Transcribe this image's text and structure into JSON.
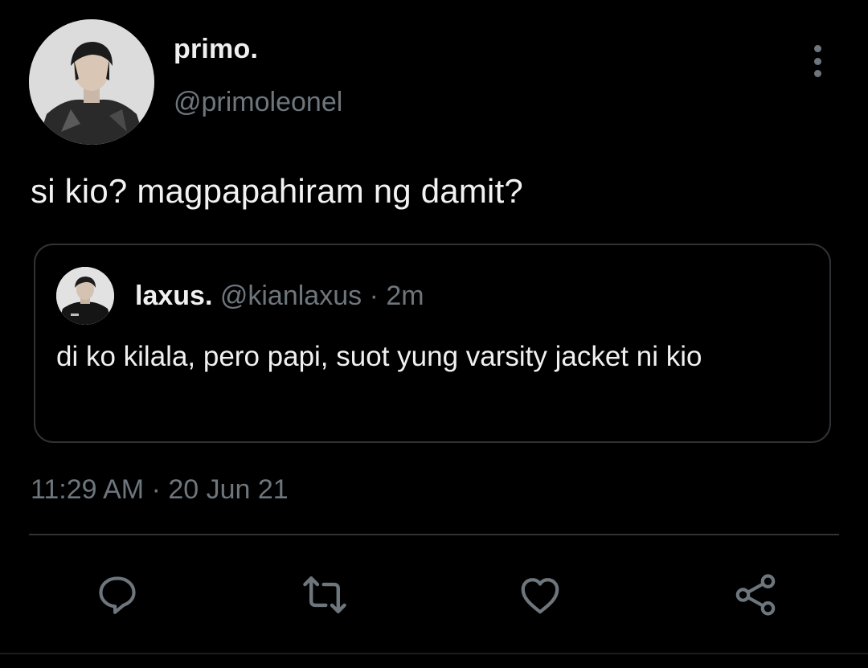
{
  "tweet": {
    "author": {
      "display_name": "primo.",
      "handle": "@primoleonel",
      "avatar_icon": "profile-photo"
    },
    "text": "si kio? magpapahiram ng damit?",
    "timestamp": "11:29 AM · 20 Jun 21"
  },
  "quote": {
    "author": {
      "display_name": "laxus.",
      "handle": "@kianlaxus",
      "separator": "·",
      "time_ago": "2m",
      "avatar_icon": "profile-photo"
    },
    "text": "di ko kilala, pero papi, suot yung varsity jacket ni kio"
  },
  "actions": [
    {
      "name": "reply",
      "icon": "comment-bubble-icon"
    },
    {
      "name": "retweet",
      "icon": "retweet-icon"
    },
    {
      "name": "like",
      "icon": "heart-icon"
    },
    {
      "name": "share",
      "icon": "share-icon"
    }
  ],
  "colors": {
    "background": "#000000",
    "primary_text": "#e7e9ea",
    "secondary_text": "#6e767d",
    "border": "#2f3336"
  }
}
